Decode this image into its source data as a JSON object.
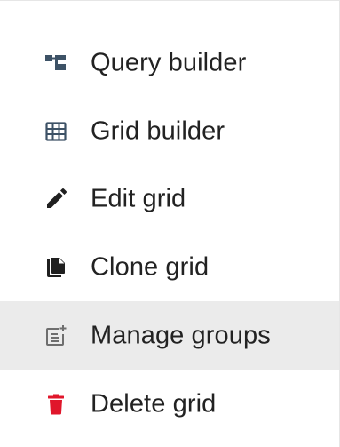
{
  "menu": {
    "items": [
      {
        "label": "Query builder",
        "icon": "query-builder-icon"
      },
      {
        "label": "Grid builder",
        "icon": "grid-icon"
      },
      {
        "label": "Edit grid",
        "icon": "pencil-icon"
      },
      {
        "label": "Clone grid",
        "icon": "clone-icon"
      },
      {
        "label": "Manage groups",
        "icon": "manage-groups-icon",
        "highlighted": true
      },
      {
        "label": "Delete grid",
        "icon": "trash-icon"
      }
    ]
  },
  "colors": {
    "icon_default": "#3d5266",
    "icon_dark": "#1f1f1f",
    "icon_muted": "#6e6e6e",
    "danger": "#e0162b",
    "highlight_bg": "#ebebeb",
    "text": "#222222"
  }
}
